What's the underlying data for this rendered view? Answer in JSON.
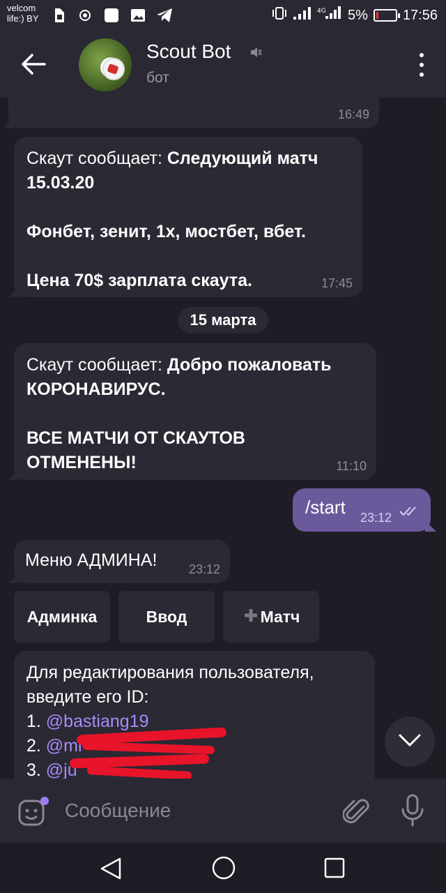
{
  "status": {
    "carrier_line1": "velcom",
    "carrier_line2": "life:) BY",
    "battery": "5%",
    "time": "17:56"
  },
  "header": {
    "title": "Scout Bot",
    "subtitle": "бот"
  },
  "messages": {
    "m0_time": "16:49",
    "m1_prefix": "Скаут сообщает: ",
    "m1_bold_1": "Следующий матч",
    "m1_bold_2": "15.03.20",
    "m1_bold_3": "Фонбет, зенит, 1х, мостбет, вбет.",
    "m1_bold_4": "Цена 70$ зарплата скаута.",
    "m1_time": "17:45",
    "date_divider": "15 марта",
    "m2_prefix": "Скаут сообщает: ",
    "m2_bold_1": "Добро пожаловать",
    "m2_bold_2": "КОРОНАВИРУС.",
    "m2_bold_3": "ВСЕ МАТЧИ ОТ СКАУТОВ",
    "m2_bold_4": "ОТМЕНЕНЫ!",
    "m2_time": "11:10",
    "m3_text": "/start",
    "m3_time": "23:12",
    "m4_text": "Меню АДМИНА!",
    "m4_time": "23:12",
    "m5_line1": "Для редактирования пользователя,",
    "m5_line2": "введите его ID:",
    "m5_item1_num": "1. ",
    "m5_item1_link": "@bastiang19",
    "m5_item2_num": "2. ",
    "m5_item2_link": "@mi",
    "m5_item3_num": "3. ",
    "m5_item3_link": "@ju"
  },
  "keyboard": {
    "btn1": "Админка",
    "btn2": "Ввод",
    "btn3": "Матч"
  },
  "input": {
    "placeholder": "Сообщение"
  },
  "colors": {
    "background": "#1e1c25",
    "bubble_in": "#2b2933",
    "bubble_out": "#6a5a9c",
    "link": "#a78bfa",
    "redaction": "#e8142a"
  }
}
